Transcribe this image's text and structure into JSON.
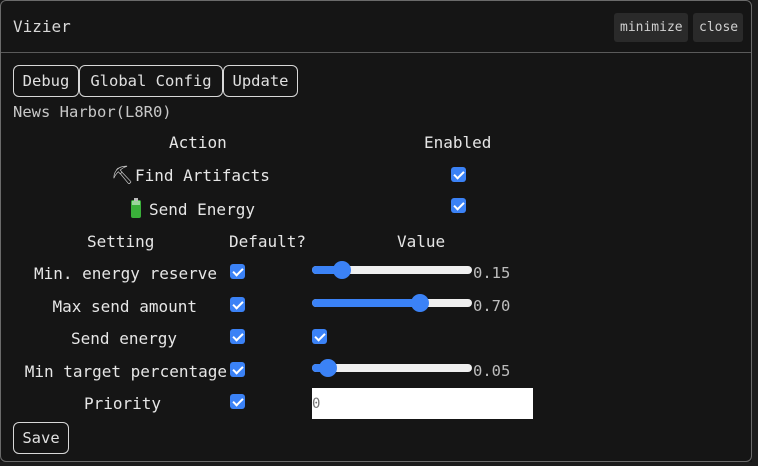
{
  "window": {
    "title": "Vizier",
    "minimize_label": "minimize",
    "close_label": "close"
  },
  "tabs": [
    {
      "label": "Debug"
    },
    {
      "label": "Global Config"
    },
    {
      "label": "Update"
    }
  ],
  "plugin": {
    "name": "News Harbor(L8R0)"
  },
  "actions": {
    "header_action": "Action",
    "header_enabled": "Enabled",
    "rows": [
      {
        "icon": "pickaxe-icon",
        "label": "Find Artifacts",
        "enabled": true
      },
      {
        "icon": "battery-icon",
        "label": "Send Energy",
        "enabled": true
      }
    ]
  },
  "settings": {
    "header_setting": "Setting",
    "header_default": "Default?",
    "header_value": "Value",
    "rows": [
      {
        "label": "Min. energy reserve",
        "default": true,
        "type": "slider",
        "value": 0.15,
        "value_text": "0.15"
      },
      {
        "label": "Max send amount",
        "default": true,
        "type": "slider",
        "value": 0.7,
        "value_text": "0.70"
      },
      {
        "label": "Send energy",
        "default": true,
        "type": "checkbox",
        "value": true
      },
      {
        "label": "Min target percentage",
        "default": true,
        "type": "slider",
        "value": 0.05,
        "value_text": "0.05"
      },
      {
        "label": "Priority",
        "default": true,
        "type": "number",
        "placeholder": "0"
      }
    ]
  },
  "save_label": "Save",
  "colors": {
    "accent": "#3b82f6",
    "background": "#151515",
    "border": "#d8d8d8"
  }
}
